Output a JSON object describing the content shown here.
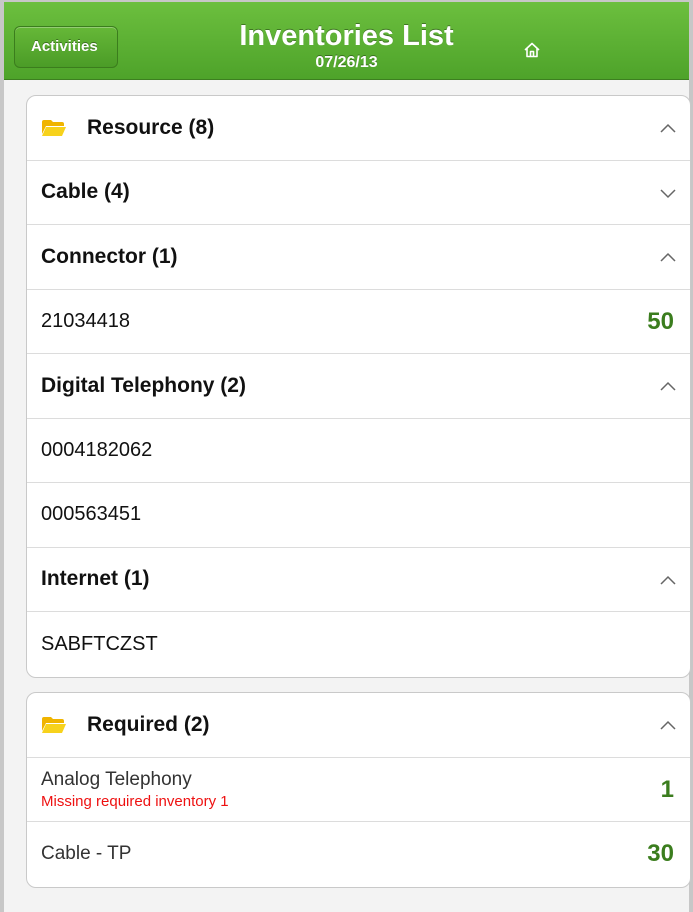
{
  "header": {
    "back_label": "Activities",
    "title": "Inventories List",
    "date": "07/26/13"
  },
  "resource_group": {
    "label": "Resource (8)",
    "subgroups": [
      {
        "label": "Cable (4)",
        "state": "collapsed",
        "items": []
      },
      {
        "label": "Connector (1)",
        "state": "expanded",
        "items": [
          {
            "id": "21034418",
            "qty": "50"
          }
        ]
      },
      {
        "label": "Digital Telephony (2)",
        "state": "expanded",
        "items": [
          {
            "id": "0004182062",
            "qty": ""
          },
          {
            "id": "000563451",
            "qty": ""
          }
        ]
      },
      {
        "label": "Internet (1)",
        "state": "expanded",
        "items": [
          {
            "id": "SABFTCZST",
            "qty": ""
          }
        ]
      }
    ]
  },
  "required_group": {
    "label": "Required (2)",
    "items": [
      {
        "name": "Analog Telephony",
        "warning": "Missing required inventory 1",
        "qty": "1"
      },
      {
        "name": "Cable - TP",
        "warning": "",
        "qty": "30"
      }
    ]
  },
  "colors": {
    "header_green": "#4ea32a",
    "qty_green": "#3b7d1e",
    "warning_red": "#e11111",
    "folder_yellow": "#f5c518"
  }
}
